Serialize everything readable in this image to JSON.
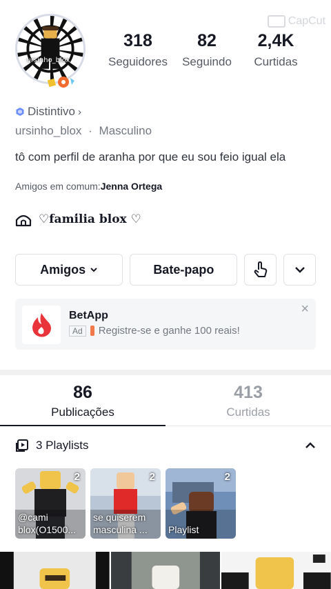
{
  "watermark": {
    "text": "CapCut"
  },
  "avatar": {
    "name": "ursinho_blox"
  },
  "stats": [
    {
      "num": "318",
      "label": "Seguidores"
    },
    {
      "num": "82",
      "label": "Seguindo"
    },
    {
      "num": "2,4K",
      "label": "Curtidas"
    }
  ],
  "badge": {
    "label": "Distintivo"
  },
  "user": {
    "username": "ursinho_blox",
    "separator": "·",
    "gender": "Masculino"
  },
  "bio": "tô com perfil de aranha por que eu sou feio igual ela",
  "mutual": {
    "prefix": "Amigos em comum:",
    "name": "Jenna Ortega"
  },
  "family": {
    "text": "♡𝐟𝐚𝐦𝐢́𝐥𝐢𝐚 𝐛𝐥𝐨𝐱 ♡"
  },
  "actions": {
    "friends": "Amigos",
    "chat": "Bate-papo"
  },
  "ad": {
    "title": "BetApp",
    "tag": "Ad",
    "text": "Registre-se e ganhe 100 reais!",
    "close": "×"
  },
  "tabs": [
    {
      "num": "86",
      "label": "Publicações"
    },
    {
      "num": "413",
      "label": "Curtidas"
    }
  ],
  "playlists": {
    "title": "3 Playlists",
    "items": [
      {
        "count": "2",
        "caption": "@cami\nblox(O1500..."
      },
      {
        "count": "2",
        "caption": "se quiserem\nmasculina ..."
      },
      {
        "count": "2",
        "caption": "Playlist"
      }
    ]
  },
  "colors": {
    "accent": "#161823",
    "ad_logo": "#e8343a",
    "badge": "#6b8cff"
  }
}
